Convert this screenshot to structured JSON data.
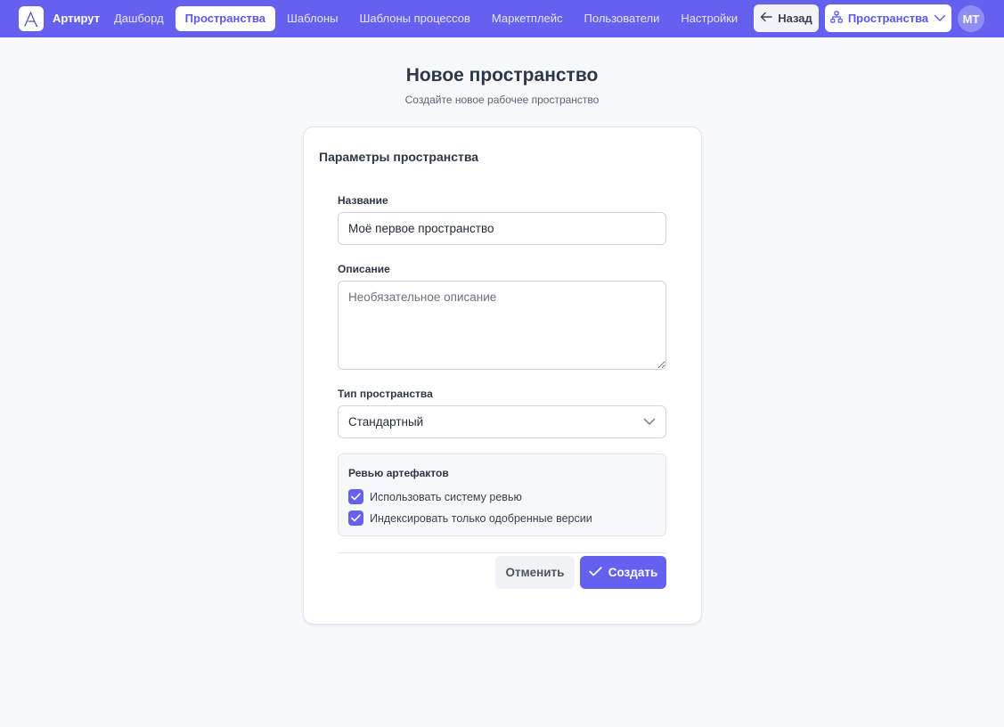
{
  "topbar": {
    "brand": "Артирут",
    "nav": [
      {
        "label": "Дашборд",
        "active": false
      },
      {
        "label": "Пространства",
        "active": true
      },
      {
        "label": "Шаблоны",
        "active": false
      },
      {
        "label": "Шаблоны процессов",
        "active": false
      },
      {
        "label": "Маркетплейс",
        "active": false
      },
      {
        "label": "Пользователи",
        "active": false
      },
      {
        "label": "Настройки",
        "active": false
      }
    ],
    "back_label": "Назад",
    "workspace_switcher_label": "Пространства",
    "avatar_initials": "МТ",
    "accent_color": "#6561ee"
  },
  "header": {
    "title": "Новое пространство",
    "subtitle": "Создайте новое рабочее пространство"
  },
  "form": {
    "section_title": "Параметры пространства",
    "name": {
      "label": "Название",
      "value": "Моё первое пространство"
    },
    "description": {
      "label": "Описание",
      "placeholder": "Необязательное описание",
      "value": ""
    },
    "type": {
      "label": "Тип пространства",
      "selected": "Стандартный"
    },
    "review": {
      "title": "Ревью артефактов",
      "options": [
        {
          "label": "Использовать систему ревью",
          "checked": true
        },
        {
          "label": "Индексировать только одобренные версии",
          "checked": true
        }
      ]
    },
    "cancel_label": "Отменить",
    "submit_label": "Создать"
  },
  "icons": {
    "logo": "logo-a-icon",
    "back": "arrow-left-icon",
    "workspace": "hierarchy-icon",
    "dropdown": "chevron-down-icon",
    "check": "check-icon"
  }
}
